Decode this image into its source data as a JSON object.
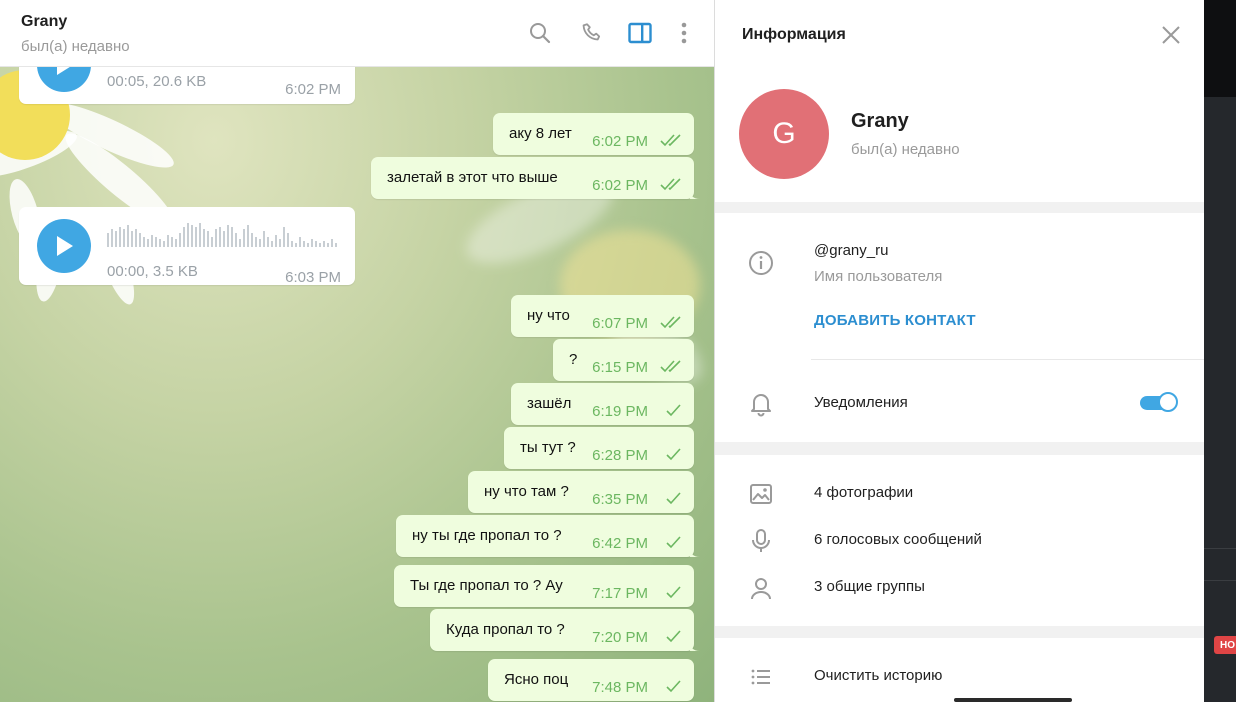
{
  "chat": {
    "title": "Grany",
    "status": "был(а) недавно",
    "icons": {
      "search": "search-icon",
      "call": "phone-icon",
      "sidebar": "sidebar-toggle-icon",
      "more": "more-vertical-icon"
    },
    "voice_messages": [
      {
        "meta": "00:05, 20.6 KB",
        "time": "6:02 PM"
      },
      {
        "meta": "00:00, 3.5 KB",
        "time": "6:03 PM"
      }
    ],
    "messages": [
      {
        "text": "аку 8 лет",
        "time": "6:02 PM",
        "status": "read"
      },
      {
        "text": "залетай в этот что выше",
        "time": "6:02 PM",
        "status": "read"
      },
      {
        "text": "ну что",
        "time": "6:07 PM",
        "status": "read"
      },
      {
        "text": "?",
        "time": "6:15 PM",
        "status": "read"
      },
      {
        "text": "зашёл",
        "time": "6:19 PM",
        "status": "sent"
      },
      {
        "text": "ты тут ?",
        "time": "6:28 PM",
        "status": "sent"
      },
      {
        "text": "ну что там ?",
        "time": "6:35 PM",
        "status": "sent"
      },
      {
        "text": "ну ты где пропал то ?",
        "time": "6:42 PM",
        "status": "sent"
      },
      {
        "text": "Ты где пропал то ? Ау",
        "time": "7:17 PM",
        "status": "sent"
      },
      {
        "text": "Куда пропал то ?",
        "time": "7:20 PM",
        "status": "sent"
      },
      {
        "text": "Ясно поц",
        "time": "7:48 PM",
        "status": "sent"
      }
    ],
    "colors": {
      "outgoing_bubble": "#effdde",
      "time_green": "#6cb761",
      "play_button": "#40a7e3"
    }
  },
  "info": {
    "title": "Информация",
    "avatar_letter": "G",
    "avatar_color": "#e17076",
    "name": "Grany",
    "status": "был(а) недавно",
    "username": "@grany_ru",
    "username_label": "Имя пользователя",
    "add_contact": "ДОБАВИТЬ КОНТАКТ",
    "notifications_label": "Уведомления",
    "notifications_enabled": true,
    "media": {
      "photos": "4 фотографии",
      "voice": "6 голосовых сообщений",
      "groups": "3 общие группы"
    },
    "clear_history": "Очистить историю",
    "accent": "#2c8ed0"
  },
  "right_strip": {
    "badge": "НО"
  }
}
